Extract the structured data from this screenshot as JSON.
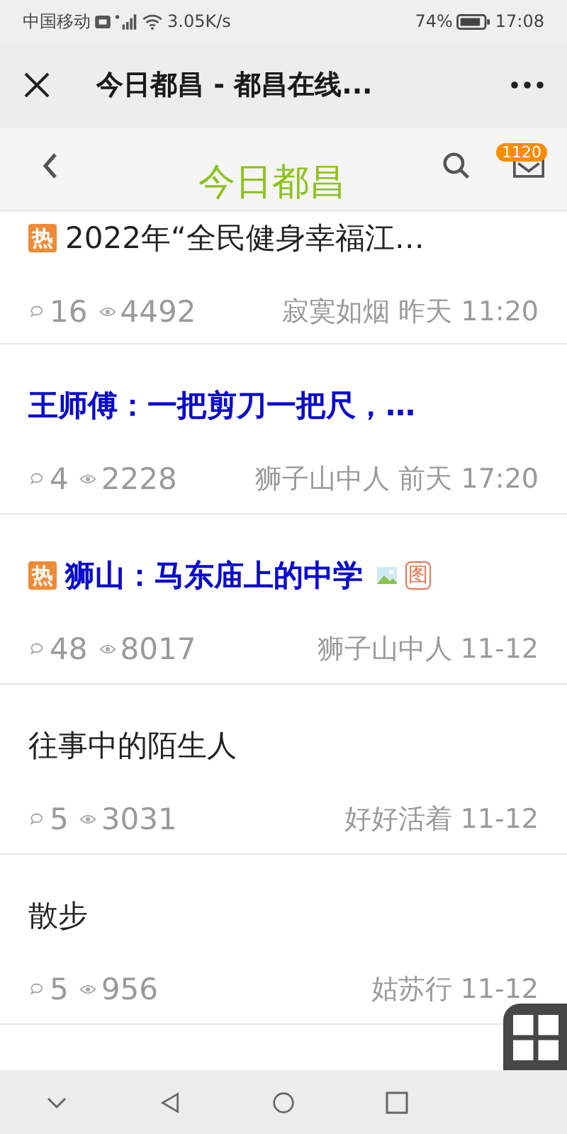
{
  "status_bar": {
    "carrier": "中国移动",
    "speed": "3.05K/s",
    "battery": "74%",
    "time": "17:08"
  },
  "window": {
    "title": "今日都昌 - 都昌在线..."
  },
  "header": {
    "title": "今日都昌",
    "badge": "1120"
  },
  "posts": [
    {
      "title": "2022年“全民健身幸福江…",
      "bold": false,
      "hot": true,
      "hot_label": "热",
      "has_image": false,
      "comments": "16",
      "views": "4492",
      "author": "寂寞如烟",
      "time": "昨天 11:20"
    },
    {
      "title": "王师傅：一把剪刀一把尺，…",
      "bold": true,
      "hot": false,
      "has_image": false,
      "comments": "4",
      "views": "2228",
      "author": "狮子山中人",
      "time": "前天 17:20"
    },
    {
      "title": "狮山：马东庙上的中学",
      "bold": true,
      "hot": true,
      "hot_label": "热",
      "has_image": true,
      "image_tag": "图",
      "comments": "48",
      "views": "8017",
      "author": "狮子山中人",
      "time": "11-12"
    },
    {
      "title": "往事中的陌生人",
      "bold": false,
      "hot": false,
      "has_image": false,
      "comments": "5",
      "views": "3031",
      "author": "好好活着",
      "time": "11-12"
    },
    {
      "title": "散步",
      "bold": false,
      "hot": false,
      "has_image": false,
      "comments": "5",
      "views": "956",
      "author": "姑苏行",
      "time": "11-12"
    }
  ]
}
